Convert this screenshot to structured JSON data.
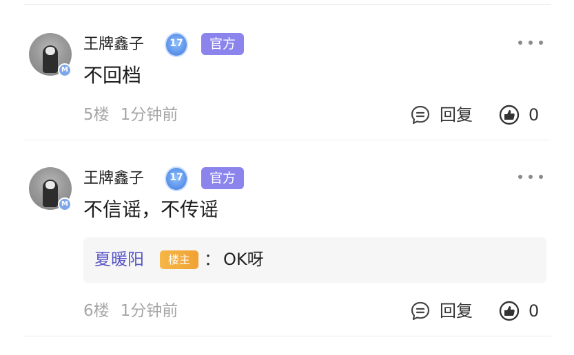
{
  "comments": [
    {
      "username": "王牌鑫子",
      "level": "17",
      "official_badge": "官方",
      "avatar_badge": "M",
      "content": "不回档",
      "floor": "5楼",
      "time": "1分钟前",
      "reply_label": "回复",
      "like_count": "0"
    },
    {
      "username": "王牌鑫子",
      "level": "17",
      "official_badge": "官方",
      "avatar_badge": "M",
      "content": "不信谣，不传谣",
      "quote": {
        "author": "夏暖阳",
        "owner_badge": "楼主",
        "colon": "：",
        "text": "OK呀"
      },
      "floor": "6楼",
      "time": "1分钟前",
      "reply_label": "回复",
      "like_count": "0"
    }
  ],
  "icons": [
    "more-icon",
    "reply-icon",
    "like-icon",
    "level-badge-icon",
    "avatar-member-badge"
  ],
  "colors": {
    "official_badge": "#8a84ec",
    "owner_badge": "#f0a233",
    "quote_author": "#5a57c8",
    "level_badge": "#5f95ea",
    "meta_text": "#a6a6a6"
  }
}
